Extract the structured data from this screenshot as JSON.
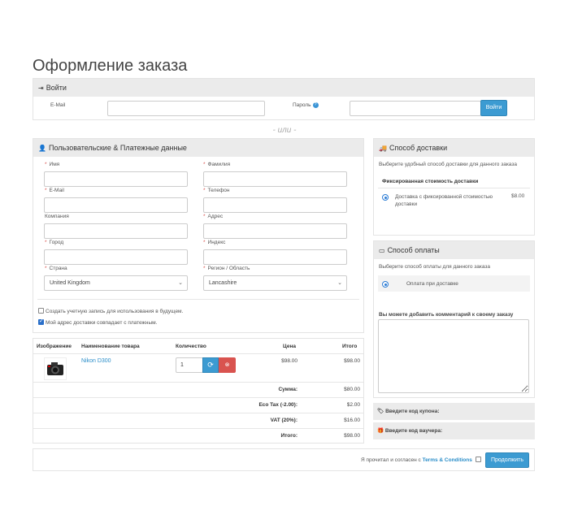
{
  "page": {
    "title": "Оформление заказа"
  },
  "login": {
    "header": "Войти",
    "email_label": "E-Mail",
    "password_label": "Пароль",
    "help_icon": "question-circle-icon",
    "button": "Войти",
    "email_value": "",
    "password_value": ""
  },
  "or_divider": "- или -",
  "personal": {
    "header": "Пользовательские & Платежные данные",
    "first_name": "Имя",
    "last_name": "Фамилия",
    "email": "E-Mail",
    "phone": "Телефон",
    "company": "Компания",
    "address": "Адрес",
    "city": "Город",
    "postcode": "Индекс",
    "country": "Страна",
    "country_value": "United Kingdom",
    "region": "Регион / Область",
    "region_value": "Lancashire",
    "create_account": "Создать учетную запись для использования в будущем.",
    "create_account_checked": false,
    "same_address": "Мой адрес доставки совпадает с платежным.",
    "same_address_checked": true
  },
  "cart": {
    "headers": {
      "image": "Изображение",
      "name": "Наименование товара",
      "qty": "Количество",
      "price": "Цена",
      "total": "Итого"
    },
    "items": [
      {
        "name": "Nikon D300",
        "qty": "1",
        "price": "$98.00",
        "total": "$98.00"
      }
    ],
    "totals": [
      {
        "label": "Сумма:",
        "value": "$80.00"
      },
      {
        "label": "Eco Tax (-2.00):",
        "value": "$2.00"
      },
      {
        "label": "VAT (20%):",
        "value": "$16.00"
      },
      {
        "label": "Итого:",
        "value": "$98.00"
      }
    ]
  },
  "agree": {
    "text": "Я прочитал и согласен с",
    "link": "Terms & Conditions",
    "button": "Продолжить"
  },
  "shipping": {
    "header": "Способ доставки",
    "intro": "Выберите удобный способ доставки для данного заказа",
    "group": "Фиксированная стоимость доставки",
    "option_label": "Доставка с фиксированной стоимостью доставки",
    "option_price": "$8.00"
  },
  "payment": {
    "header": "Способ оплаты",
    "intro": "Выберите способ оплаты для данного заказа",
    "option_label": "Оплата при доставке",
    "comment_label": "Вы можете добавить комментарий к своему заказу",
    "comment_value": ""
  },
  "coupon": {
    "label": "Введите код купона:"
  },
  "voucher": {
    "label": "Введите код ваучера:"
  },
  "colors": {
    "accent": "#3c9bd2",
    "panel_header": "#ebebeb",
    "required": "#d9534f",
    "danger": "#d9534f"
  }
}
